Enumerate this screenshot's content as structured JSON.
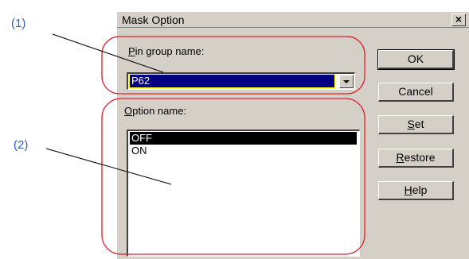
{
  "callouts": {
    "c1": "(1)",
    "c2": "(2)"
  },
  "dialog": {
    "title": "Mask Option",
    "close_glyph": "×",
    "pin_group_label": "Pin group name:",
    "pin_group_value": "P62",
    "option_label": "Option name:",
    "options": [
      "OFF",
      "ON"
    ],
    "selected_option": "OFF",
    "buttons": {
      "ok": "OK",
      "cancel": "Cancel",
      "set": "Set",
      "restore": "Restore",
      "help": "Help"
    }
  },
  "colors": {
    "annotation": "#e0202a",
    "callout_text": "#2e5fb3",
    "dialog_face": "#d4d0c8"
  }
}
